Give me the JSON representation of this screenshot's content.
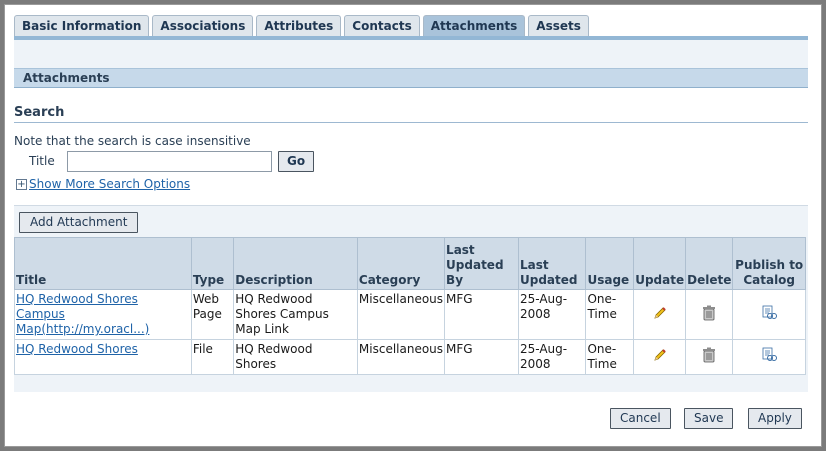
{
  "tabs": [
    "Basic Information",
    "Associations",
    "Attributes",
    "Contacts",
    "Attachments",
    "Assets"
  ],
  "active_tab": "Attachments",
  "section_title": "Attachments",
  "search": {
    "title": "Search",
    "note": "Note that the search is case insensitive",
    "title_label": "Title",
    "title_value": "",
    "go_label": "Go",
    "more_options": "Show More Search Options"
  },
  "add_attachment_label": "Add Attachment",
  "table": {
    "headers": {
      "title": "Title",
      "type": "Type",
      "description": "Description",
      "category": "Category",
      "last_updated_by": "Last Updated By",
      "last_updated": "Last Updated",
      "usage": "Usage",
      "update": "Update",
      "delete": "Delete",
      "publish": "Publish to Catalog"
    },
    "rows": [
      {
        "title": "HQ Redwood Shores Campus Map(http://my.oracl...)",
        "type": "Web Page",
        "description": "HQ Redwood Shores Campus Map Link",
        "category": "Miscellaneous",
        "last_updated_by": "MFG",
        "last_updated": "25-Aug-2008",
        "usage": "One-Time"
      },
      {
        "title": "HQ Redwood Shores",
        "type": "File",
        "description": "HQ Redwood Shores",
        "category": "Miscellaneous",
        "last_updated_by": "MFG",
        "last_updated": "25-Aug-2008",
        "usage": "One-Time"
      }
    ]
  },
  "footer": {
    "cancel": "Cancel",
    "save": "Save",
    "apply": "Apply"
  },
  "icons": {
    "update": "pencil-icon",
    "delete": "trash-icon",
    "publish": "publish-catalog-icon"
  },
  "colors": {
    "active_tab": "#a9c3da",
    "header_band": "#c6d9ea",
    "link": "#1f63a8"
  }
}
